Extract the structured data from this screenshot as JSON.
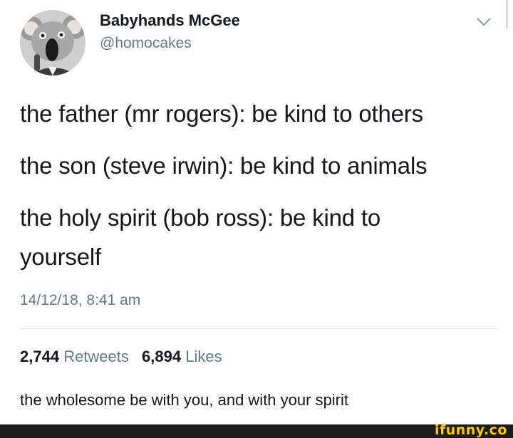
{
  "tweet": {
    "display_name": "Babyhands McGee",
    "handle": "@homocakes",
    "lines": [
      "the father (mr rogers): be kind to others",
      "the son (steve irwin): be kind to animals",
      "the holy spirit (bob ross): be kind to",
      "yourself"
    ],
    "timestamp": "14/12/18, 8:41 am",
    "retweets_count": "2,744",
    "retweets_label": "Retweets",
    "likes_count": "6,894",
    "likes_label": "Likes"
  },
  "caption": "the wholesome be with you, and with your spirit",
  "watermark": "ifunny.co",
  "icons": {
    "menu": "chevron-down-icon",
    "avatar": "koala-avatar"
  },
  "colors": {
    "text": "#14171a",
    "secondary": "#657786",
    "divider": "#e1e8ed",
    "watermark": "#ffcc00",
    "footer": "#1c1c1c"
  }
}
